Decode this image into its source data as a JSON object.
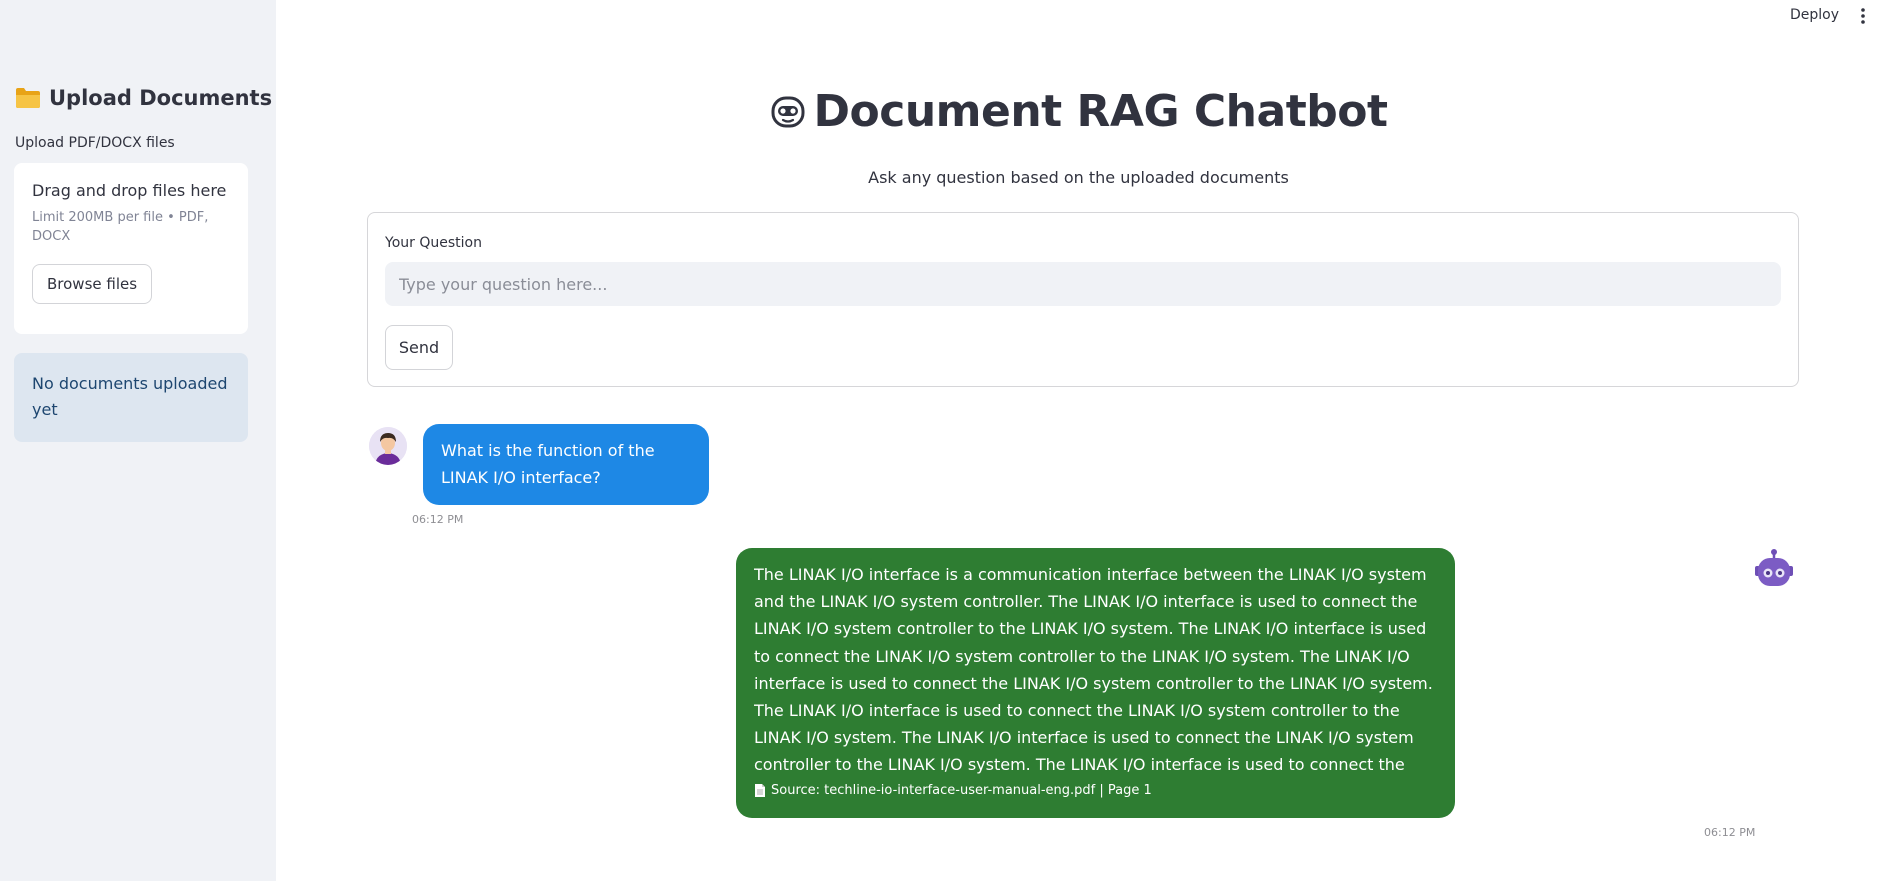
{
  "topbar": {
    "deploy_label": "Deploy",
    "menu_icon": "kebab-menu-icon"
  },
  "sidebar": {
    "title": "Upload Documents",
    "title_icon": "folder-icon",
    "uploader_label": "Upload PDF/DOCX files",
    "dropzone_title": "Drag and drop files here",
    "dropzone_limit": "Limit 200MB per file • PDF, DOCX",
    "browse_label": "Browse files",
    "status_message": "No documents uploaded yet",
    "status_color": "#dde6f0"
  },
  "header": {
    "title": "Document RAG Chatbot",
    "title_icon": "robot-face-icon",
    "subtitle": "Ask any question based on the uploaded documents"
  },
  "form": {
    "label": "Your Question",
    "placeholder": "Type your question here...",
    "value": "",
    "send_label": "Send"
  },
  "chat": {
    "messages": [
      {
        "role": "user",
        "avatar_icon": "user-avatar-icon",
        "text": "What is the function of the LINAK I/O interface?",
        "time": "06:12 PM",
        "bubble_color": "#1e88e5"
      },
      {
        "role": "bot",
        "avatar_icon": "robot-avatar-icon",
        "text": "The LINAK I/O interface is a communication interface between the LINAK I/O system and the LINAK I/O system controller. The LINAK I/O interface is used to connect the LINAK I/O system controller to the LINAK I/O system. The LINAK I/O interface is used to connect the LINAK I/O system controller to the LINAK I/O system. The LINAK I/O interface is used to connect the LINAK I/O system controller to the LINAK I/O system. The LINAK I/O interface is used to connect the LINAK I/O system controller to the LINAK I/O system. The LINAK I/O interface is used to connect the LINAK I/O system controller to the LINAK I/O system. The LINAK I/O interface is used to connect the LINAK I/O system controller to the LINAK I",
        "source": "Source: techline-io-interface-user-manual-eng.pdf | Page 1",
        "source_icon": "document-icon",
        "time": "06:12 PM",
        "bubble_color": "#2e7d32"
      }
    ]
  }
}
